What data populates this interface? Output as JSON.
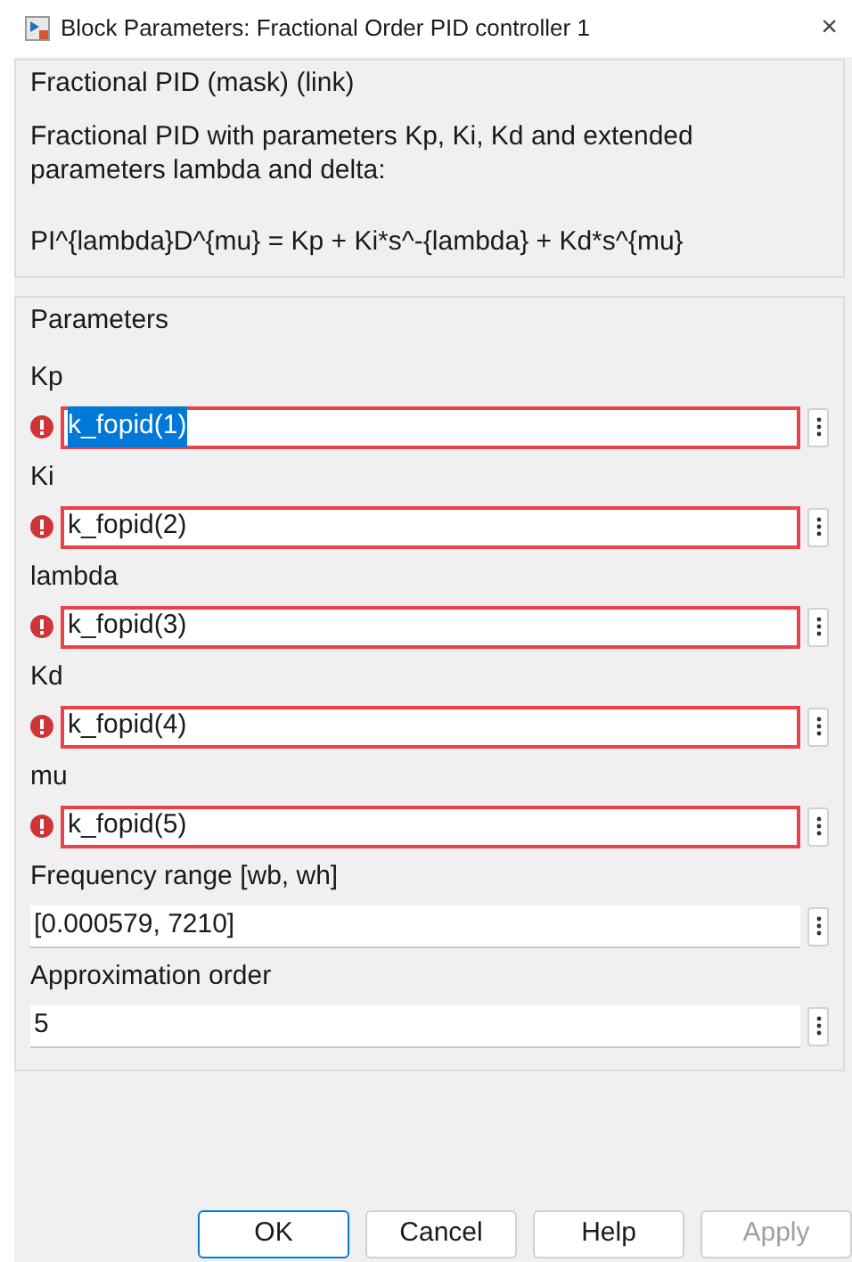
{
  "window": {
    "title": "Block Parameters: Fractional Order PID controller 1",
    "close": "×"
  },
  "description": {
    "title": "Fractional PID (mask) (link)",
    "text": "Fractional PID with parameters Kp, Ki, Kd and extended parameters lambda and delta:",
    "formula": "PI^{lambda}D^{mu} = Kp + Ki*s^-{lambda} + Kd*s^{mu}"
  },
  "parameters": {
    "title": "Parameters",
    "items": [
      {
        "label": "Kp",
        "value": "k_fopid(1)",
        "error": true,
        "selected": true
      },
      {
        "label": "Ki",
        "value": "k_fopid(2)",
        "error": true,
        "selected": false
      },
      {
        "label": "lambda",
        "value": "k_fopid(3)",
        "error": true,
        "selected": false
      },
      {
        "label": "Kd",
        "value": "k_fopid(4)",
        "error": true,
        "selected": false
      },
      {
        "label": "mu",
        "value": "k_fopid(5)",
        "error": true,
        "selected": false
      },
      {
        "label": "Frequency range [wb, wh]",
        "value": "[0.000579, 7210]",
        "error": false,
        "selected": false
      },
      {
        "label": "Approximation order",
        "value": "5",
        "error": false,
        "selected": false
      }
    ]
  },
  "buttons": [
    {
      "label": "OK",
      "focused": true,
      "disabled": false
    },
    {
      "label": "Cancel",
      "focused": false,
      "disabled": false
    },
    {
      "label": "Help",
      "focused": false,
      "disabled": false
    },
    {
      "label": "Apply",
      "focused": false,
      "disabled": true
    }
  ]
}
